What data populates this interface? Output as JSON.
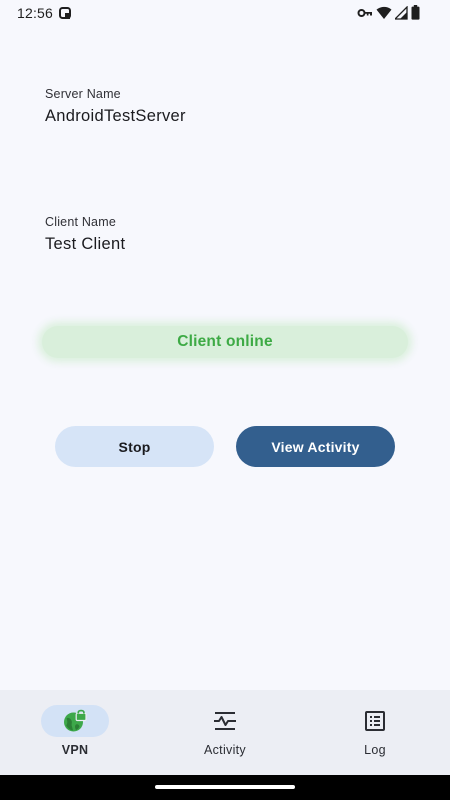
{
  "status_bar": {
    "time": "12:56"
  },
  "server": {
    "label": "Server Name",
    "value": "AndroidTestServer"
  },
  "client": {
    "label": "Client Name",
    "value": "Test Client"
  },
  "status": {
    "text": "Client online",
    "color": "#3daa45"
  },
  "actions": {
    "stop_label": "Stop",
    "view_activity_label": "View Activity"
  },
  "bottom_nav": {
    "items": [
      {
        "label": "VPN",
        "icon": "vpn-globe-lock-icon",
        "active": true
      },
      {
        "label": "Activity",
        "icon": "activity-pulse-icon",
        "active": false
      },
      {
        "label": "Log",
        "icon": "log-list-icon",
        "active": false
      }
    ]
  },
  "colors": {
    "background": "#f7f8fd",
    "primary": "#335f8e",
    "secondary_container": "#d6e4f7",
    "online_green": "#3daa45",
    "nav_background": "#eceef4"
  }
}
